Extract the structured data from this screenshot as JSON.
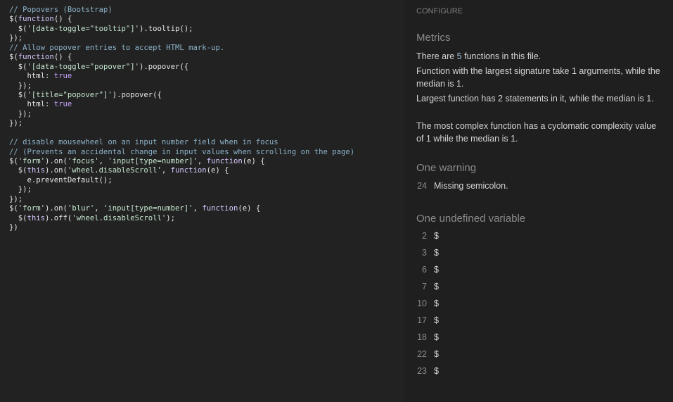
{
  "code": {
    "lines": [
      [
        {
          "t": "// Popovers (Bootstrap)",
          "c": "comment"
        }
      ],
      [
        {
          "t": "$",
          "c": "plain"
        },
        {
          "t": "(",
          "c": "plain"
        },
        {
          "t": "function",
          "c": "keyword"
        },
        {
          "t": "() {",
          "c": "plain"
        }
      ],
      [
        {
          "t": "  $(",
          "c": "plain"
        },
        {
          "t": "'[data-toggle=\"tooltip\"]'",
          "c": "string"
        },
        {
          "t": ").tooltip();",
          "c": "plain"
        }
      ],
      [
        {
          "t": "});",
          "c": "plain"
        }
      ],
      [
        {
          "t": "// Allow popover entries to accept HTML mark-up.",
          "c": "comment"
        }
      ],
      [
        {
          "t": "$",
          "c": "plain"
        },
        {
          "t": "(",
          "c": "plain"
        },
        {
          "t": "function",
          "c": "keyword"
        },
        {
          "t": "() {",
          "c": "plain"
        }
      ],
      [
        {
          "t": "  $(",
          "c": "plain"
        },
        {
          "t": "'[data-toggle=\"popover\"]'",
          "c": "string"
        },
        {
          "t": ").popover({",
          "c": "plain"
        }
      ],
      [
        {
          "t": "    html: ",
          "c": "plain"
        },
        {
          "t": "true",
          "c": "bool"
        }
      ],
      [
        {
          "t": "  });",
          "c": "plain"
        }
      ],
      [
        {
          "t": "  $(",
          "c": "plain"
        },
        {
          "t": "'[title=\"popover\"]'",
          "c": "string"
        },
        {
          "t": ").popover({",
          "c": "plain"
        }
      ],
      [
        {
          "t": "    html: ",
          "c": "plain"
        },
        {
          "t": "true",
          "c": "bool"
        }
      ],
      [
        {
          "t": "  });",
          "c": "plain"
        }
      ],
      [
        {
          "t": "});",
          "c": "plain"
        }
      ],
      [
        {
          "t": "",
          "c": "plain"
        }
      ],
      [
        {
          "t": "// disable mousewheel on an input number field when in focus",
          "c": "comment"
        }
      ],
      [
        {
          "t": "// (Prevents an accidental change in input values when scrolling on the page)",
          "c": "comment"
        }
      ],
      [
        {
          "t": "$(",
          "c": "plain"
        },
        {
          "t": "'form'",
          "c": "string"
        },
        {
          "t": ").on(",
          "c": "plain"
        },
        {
          "t": "'focus'",
          "c": "string"
        },
        {
          "t": ", ",
          "c": "plain"
        },
        {
          "t": "'input[type=number]'",
          "c": "string"
        },
        {
          "t": ", ",
          "c": "plain"
        },
        {
          "t": "function",
          "c": "keyword"
        },
        {
          "t": "(e) {",
          "c": "plain"
        }
      ],
      [
        {
          "t": "  $(",
          "c": "plain"
        },
        {
          "t": "this",
          "c": "keyword"
        },
        {
          "t": ").on(",
          "c": "plain"
        },
        {
          "t": "'wheel.disableScroll'",
          "c": "string"
        },
        {
          "t": ", ",
          "c": "plain"
        },
        {
          "t": "function",
          "c": "keyword"
        },
        {
          "t": "(e) {",
          "c": "plain"
        }
      ],
      [
        {
          "t": "    e.preventDefault();",
          "c": "plain"
        }
      ],
      [
        {
          "t": "  });",
          "c": "plain"
        }
      ],
      [
        {
          "t": "});",
          "c": "plain"
        }
      ],
      [
        {
          "t": "$(",
          "c": "plain"
        },
        {
          "t": "'form'",
          "c": "string"
        },
        {
          "t": ").on(",
          "c": "plain"
        },
        {
          "t": "'blur'",
          "c": "string"
        },
        {
          "t": ", ",
          "c": "plain"
        },
        {
          "t": "'input[type=number]'",
          "c": "string"
        },
        {
          "t": ", ",
          "c": "plain"
        },
        {
          "t": "function",
          "c": "keyword"
        },
        {
          "t": "(e) {",
          "c": "plain"
        }
      ],
      [
        {
          "t": "  $(",
          "c": "plain"
        },
        {
          "t": "this",
          "c": "keyword"
        },
        {
          "t": ").off(",
          "c": "plain"
        },
        {
          "t": "'wheel.disableScroll'",
          "c": "string"
        },
        {
          "t": ");",
          "c": "plain"
        }
      ],
      [
        {
          "t": "})",
          "c": "plain"
        }
      ]
    ]
  },
  "panel": {
    "configure_label": "CONFIGURE",
    "metrics": {
      "title": "Metrics",
      "p1_a": "There are ",
      "p1_num": "5",
      "p1_b": " functions in this file.",
      "p2": "Function with the largest signature take 1 arguments, while the median is 1.",
      "p3": "Largest function has 2 statements in it, while the median is 1.",
      "p4": "The most complex function has a cyclomatic complexity value of 1 while the median is 1."
    },
    "warnings": {
      "title": "One warning",
      "items": [
        {
          "line": "24",
          "text": "Missing semicolon."
        }
      ]
    },
    "undefined": {
      "title": "One undefined variable",
      "items": [
        {
          "line": "2",
          "text": "$"
        },
        {
          "line": "3",
          "text": "$"
        },
        {
          "line": "6",
          "text": "$"
        },
        {
          "line": "7",
          "text": "$"
        },
        {
          "line": "10",
          "text": "$"
        },
        {
          "line": "17",
          "text": "$"
        },
        {
          "line": "18",
          "text": "$"
        },
        {
          "line": "22",
          "text": "$"
        },
        {
          "line": "23",
          "text": "$"
        }
      ]
    }
  },
  "colors": {
    "background": "#222222",
    "panel_background": "#1f1f1f",
    "comment": "#8cb3c9",
    "keyword": "#d7c7ff",
    "string": "#c6e8d0",
    "number_accent": "#a7c6e0"
  }
}
